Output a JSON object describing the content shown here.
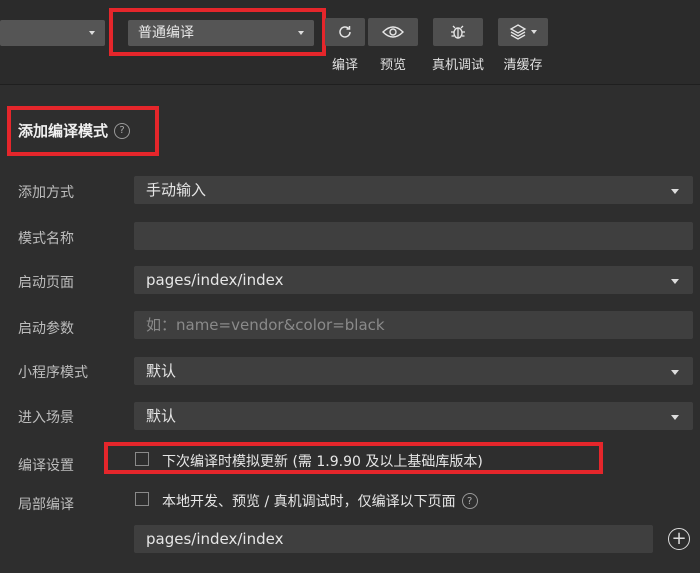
{
  "toolbar": {
    "mode_select_left": "",
    "compile_mode": "普通编译",
    "buttons": [
      {
        "label": "编译",
        "icon": "refresh-icon"
      },
      {
        "label": "预览",
        "icon": "eye-icon"
      },
      {
        "label": "真机调试",
        "icon": "bug-icon"
      },
      {
        "label": "清缓存",
        "icon": "layers-icon"
      }
    ]
  },
  "section": {
    "title": "添加编译模式",
    "help": "?"
  },
  "form": {
    "add_method": {
      "label": "添加方式",
      "value": "手动输入"
    },
    "mode_name": {
      "label": "模式名称",
      "value": ""
    },
    "start_page": {
      "label": "启动页面",
      "value": "pages/index/index"
    },
    "start_params": {
      "label": "启动参数",
      "placeholder": "如：name=vendor&color=black"
    },
    "mini_mode": {
      "label": "小程序模式",
      "value": "默认"
    },
    "scene": {
      "label": "进入场景",
      "value": "默认"
    },
    "compile_settings": {
      "label": "编译设置",
      "option": "下次编译时模拟更新 (需 1.9.90 及以上基础库版本)"
    },
    "partial_compile": {
      "label": "局部编译",
      "option": "本地开发、预览 / 真机调试时，仅编译以下页面",
      "page": "pages/index/index"
    }
  },
  "colors": {
    "accent_red": "#e5262b",
    "background": "#2e2e2e"
  }
}
